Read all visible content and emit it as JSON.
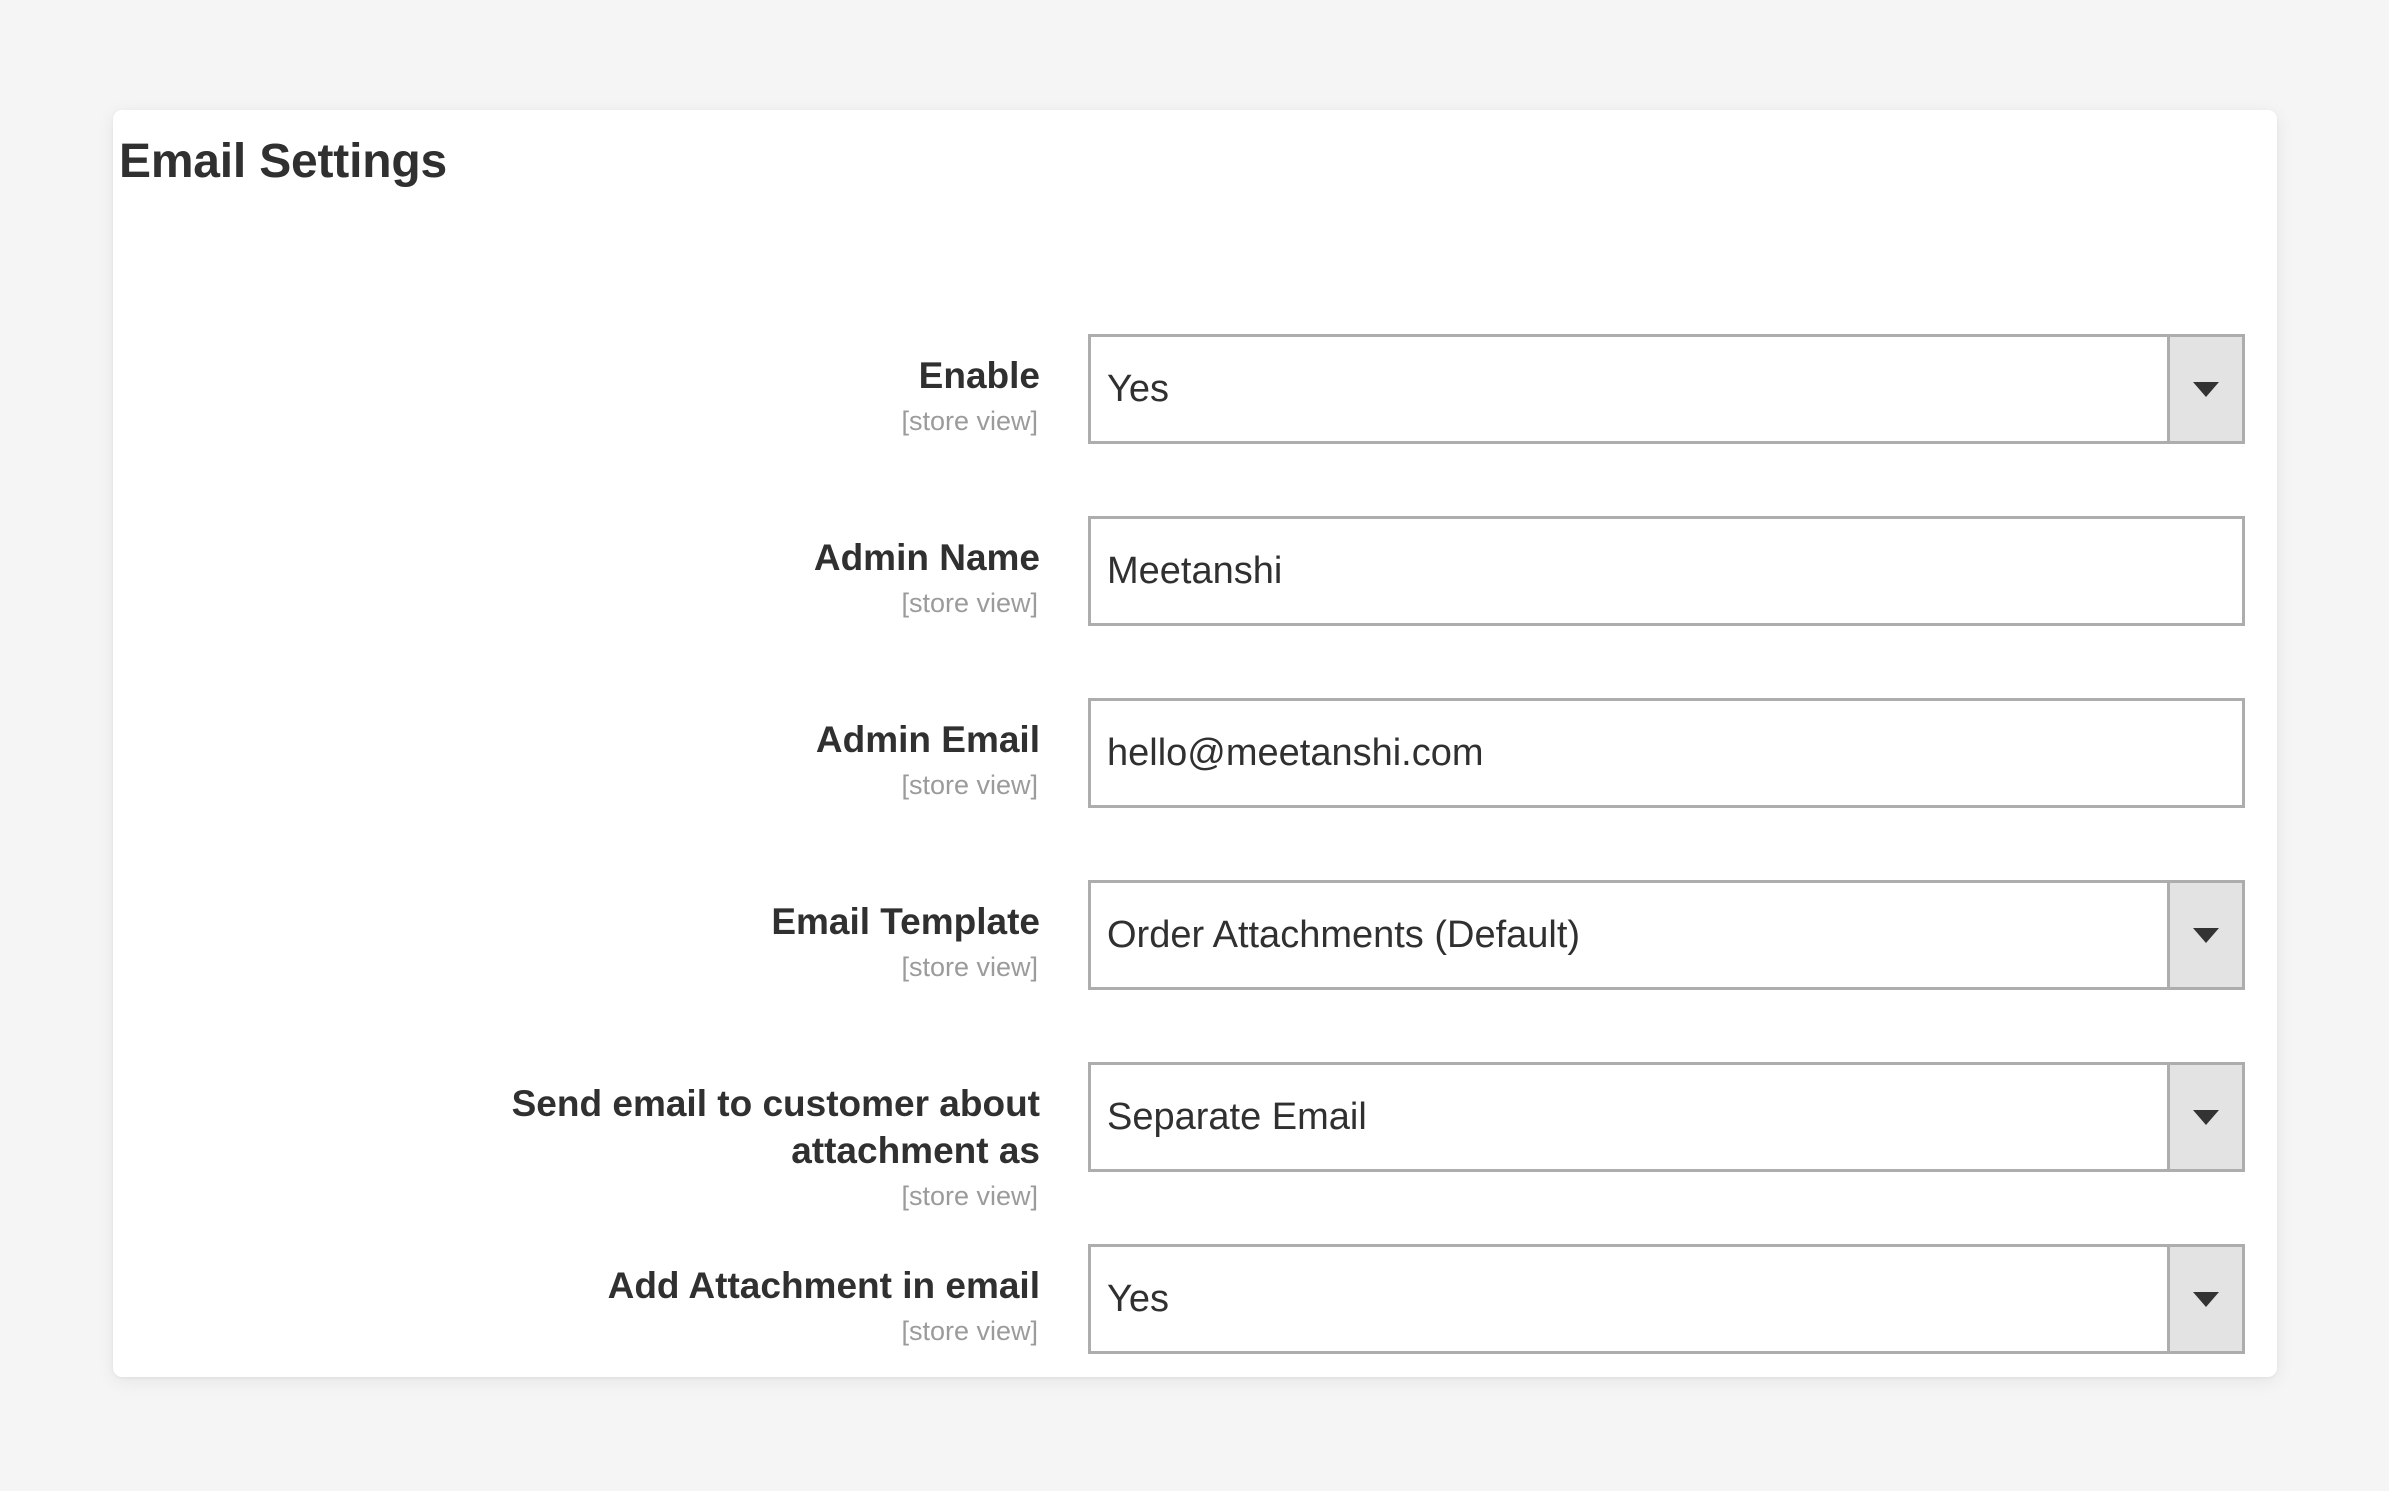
{
  "panel": {
    "title": "Email Settings"
  },
  "scope_label": "[store view]",
  "colors": {
    "page_background": "#f5f5f5",
    "panel_background": "#ffffff",
    "label_text": "#303030",
    "scope_text": "#9b9b9b",
    "field_border": "#adadad",
    "select_button_background": "#e3e3e3",
    "caret": "#333333"
  },
  "fields": [
    {
      "label": "Enable",
      "scope": "[store view]",
      "type": "select",
      "value": "Yes"
    },
    {
      "label": "Admin Name",
      "scope": "[store view]",
      "type": "text",
      "value": "Meetanshi"
    },
    {
      "label": "Admin Email",
      "scope": "[store view]",
      "type": "text",
      "value": "hello@meetanshi.com"
    },
    {
      "label": "Email Template",
      "scope": "[store view]",
      "type": "select",
      "value": "Order Attachments (Default)"
    },
    {
      "label": "Send email to customer about\nattachment as",
      "scope": "[store view]",
      "type": "select",
      "value": "Separate Email"
    },
    {
      "label": "Add Attachment in email",
      "scope": "[store view]",
      "type": "select",
      "value": "Yes"
    }
  ]
}
